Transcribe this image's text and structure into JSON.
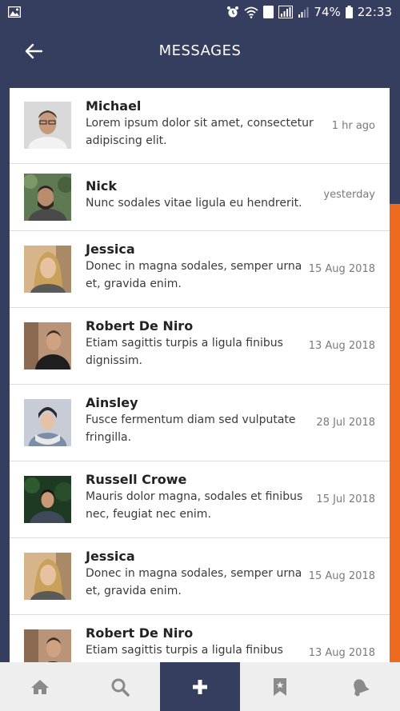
{
  "status_bar": {
    "battery_percent": "74%",
    "time": "22:33",
    "sim_label": "1"
  },
  "header": {
    "title": "MESSAGES"
  },
  "messages": [
    {
      "name": "Michael",
      "preview": "Lorem ipsum dolor sit amet, consectetur adipiscing elit.",
      "time": "1 hr ago"
    },
    {
      "name": "Nick",
      "preview": "Nunc sodales vitae ligula eu hendrerit.",
      "time": "yesterday"
    },
    {
      "name": "Jessica",
      "preview": "Donec in magna sodales, semper urna et, gravida enim.",
      "time": "15 Aug 2018"
    },
    {
      "name": "Robert De Niro",
      "preview": "Etiam sagittis turpis a ligula finibus dignissim.",
      "time": "13 Aug 2018"
    },
    {
      "name": "Ainsley",
      "preview": "Fusce fermentum diam sed vulputate fringilla.",
      "time": "28 Jul 2018"
    },
    {
      "name": "Russell Crowe",
      "preview": "Mauris dolor magna, sodales et finibus nec, feugiat nec enim.",
      "time": "15 Jul 2018"
    },
    {
      "name": "Jessica",
      "preview": "Donec in magna sodales, semper urna et, gravida enim.",
      "time": "15 Aug 2018"
    },
    {
      "name": "Robert De Niro",
      "preview": "Etiam sagittis turpis a ligula finibus",
      "time": "13 Aug 2018"
    }
  ],
  "bottom_nav": {
    "items": [
      {
        "icon": "home-icon"
      },
      {
        "icon": "search-icon"
      },
      {
        "icon": "plus-icon",
        "active": true
      },
      {
        "icon": "bookmark-icon"
      },
      {
        "icon": "bell-icon"
      }
    ]
  },
  "colors": {
    "header_bg": "#353e5e",
    "accent": "#ee6a1f",
    "nav_bg": "#eeeeee"
  }
}
